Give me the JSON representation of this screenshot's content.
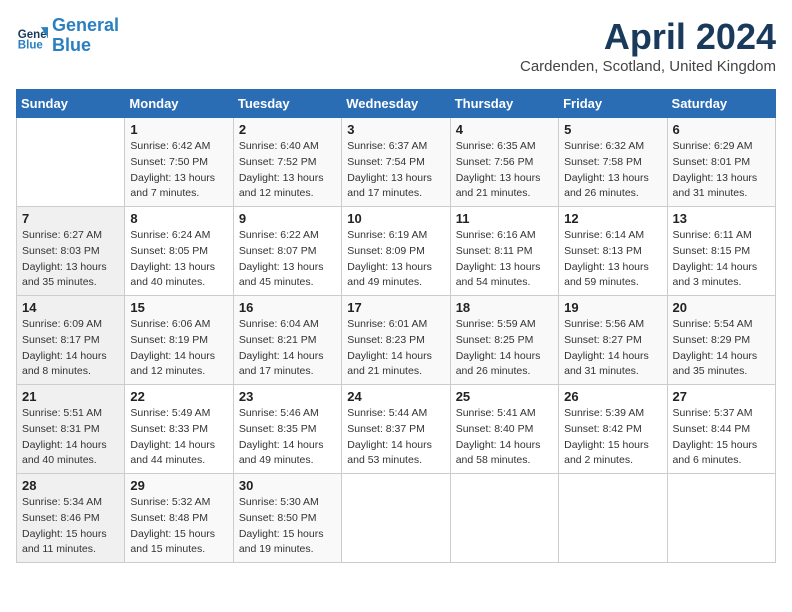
{
  "logo": {
    "line1": "General",
    "line2": "Blue"
  },
  "title": "April 2024",
  "subtitle": "Cardenden, Scotland, United Kingdom",
  "days_header": [
    "Sunday",
    "Monday",
    "Tuesday",
    "Wednesday",
    "Thursday",
    "Friday",
    "Saturday"
  ],
  "weeks": [
    [
      {
        "day": "",
        "info": ""
      },
      {
        "day": "1",
        "info": "Sunrise: 6:42 AM\nSunset: 7:50 PM\nDaylight: 13 hours\nand 7 minutes."
      },
      {
        "day": "2",
        "info": "Sunrise: 6:40 AM\nSunset: 7:52 PM\nDaylight: 13 hours\nand 12 minutes."
      },
      {
        "day": "3",
        "info": "Sunrise: 6:37 AM\nSunset: 7:54 PM\nDaylight: 13 hours\nand 17 minutes."
      },
      {
        "day": "4",
        "info": "Sunrise: 6:35 AM\nSunset: 7:56 PM\nDaylight: 13 hours\nand 21 minutes."
      },
      {
        "day": "5",
        "info": "Sunrise: 6:32 AM\nSunset: 7:58 PM\nDaylight: 13 hours\nand 26 minutes."
      },
      {
        "day": "6",
        "info": "Sunrise: 6:29 AM\nSunset: 8:01 PM\nDaylight: 13 hours\nand 31 minutes."
      }
    ],
    [
      {
        "day": "7",
        "info": "Sunrise: 6:27 AM\nSunset: 8:03 PM\nDaylight: 13 hours\nand 35 minutes."
      },
      {
        "day": "8",
        "info": "Sunrise: 6:24 AM\nSunset: 8:05 PM\nDaylight: 13 hours\nand 40 minutes."
      },
      {
        "day": "9",
        "info": "Sunrise: 6:22 AM\nSunset: 8:07 PM\nDaylight: 13 hours\nand 45 minutes."
      },
      {
        "day": "10",
        "info": "Sunrise: 6:19 AM\nSunset: 8:09 PM\nDaylight: 13 hours\nand 49 minutes."
      },
      {
        "day": "11",
        "info": "Sunrise: 6:16 AM\nSunset: 8:11 PM\nDaylight: 13 hours\nand 54 minutes."
      },
      {
        "day": "12",
        "info": "Sunrise: 6:14 AM\nSunset: 8:13 PM\nDaylight: 13 hours\nand 59 minutes."
      },
      {
        "day": "13",
        "info": "Sunrise: 6:11 AM\nSunset: 8:15 PM\nDaylight: 14 hours\nand 3 minutes."
      }
    ],
    [
      {
        "day": "14",
        "info": "Sunrise: 6:09 AM\nSunset: 8:17 PM\nDaylight: 14 hours\nand 8 minutes."
      },
      {
        "day": "15",
        "info": "Sunrise: 6:06 AM\nSunset: 8:19 PM\nDaylight: 14 hours\nand 12 minutes."
      },
      {
        "day": "16",
        "info": "Sunrise: 6:04 AM\nSunset: 8:21 PM\nDaylight: 14 hours\nand 17 minutes."
      },
      {
        "day": "17",
        "info": "Sunrise: 6:01 AM\nSunset: 8:23 PM\nDaylight: 14 hours\nand 21 minutes."
      },
      {
        "day": "18",
        "info": "Sunrise: 5:59 AM\nSunset: 8:25 PM\nDaylight: 14 hours\nand 26 minutes."
      },
      {
        "day": "19",
        "info": "Sunrise: 5:56 AM\nSunset: 8:27 PM\nDaylight: 14 hours\nand 31 minutes."
      },
      {
        "day": "20",
        "info": "Sunrise: 5:54 AM\nSunset: 8:29 PM\nDaylight: 14 hours\nand 35 minutes."
      }
    ],
    [
      {
        "day": "21",
        "info": "Sunrise: 5:51 AM\nSunset: 8:31 PM\nDaylight: 14 hours\nand 40 minutes."
      },
      {
        "day": "22",
        "info": "Sunrise: 5:49 AM\nSunset: 8:33 PM\nDaylight: 14 hours\nand 44 minutes."
      },
      {
        "day": "23",
        "info": "Sunrise: 5:46 AM\nSunset: 8:35 PM\nDaylight: 14 hours\nand 49 minutes."
      },
      {
        "day": "24",
        "info": "Sunrise: 5:44 AM\nSunset: 8:37 PM\nDaylight: 14 hours\nand 53 minutes."
      },
      {
        "day": "25",
        "info": "Sunrise: 5:41 AM\nSunset: 8:40 PM\nDaylight: 14 hours\nand 58 minutes."
      },
      {
        "day": "26",
        "info": "Sunrise: 5:39 AM\nSunset: 8:42 PM\nDaylight: 15 hours\nand 2 minutes."
      },
      {
        "day": "27",
        "info": "Sunrise: 5:37 AM\nSunset: 8:44 PM\nDaylight: 15 hours\nand 6 minutes."
      }
    ],
    [
      {
        "day": "28",
        "info": "Sunrise: 5:34 AM\nSunset: 8:46 PM\nDaylight: 15 hours\nand 11 minutes."
      },
      {
        "day": "29",
        "info": "Sunrise: 5:32 AM\nSunset: 8:48 PM\nDaylight: 15 hours\nand 15 minutes."
      },
      {
        "day": "30",
        "info": "Sunrise: 5:30 AM\nSunset: 8:50 PM\nDaylight: 15 hours\nand 19 minutes."
      },
      {
        "day": "",
        "info": ""
      },
      {
        "day": "",
        "info": ""
      },
      {
        "day": "",
        "info": ""
      },
      {
        "day": "",
        "info": ""
      }
    ]
  ]
}
